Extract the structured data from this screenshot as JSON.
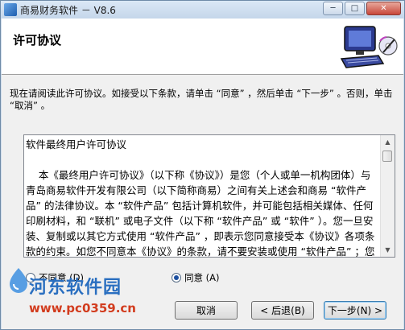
{
  "window": {
    "title": "商易财务软件 － V8.6",
    "minimize_icon": "minimize-icon",
    "maximize_icon": "maximize-icon",
    "close_icon": "close-icon"
  },
  "header": {
    "title": "许可协议",
    "graphic": "computer-disk-icon"
  },
  "intro": "现在请阅读此许可协议。如接受以下条款，请单击 “同意” ，然后单击 “下一步” 。否则，单击 “取消” 。",
  "license": {
    "text": "软件最终用户许可协议\n\n    本《最终用户许可协议》（以下称《协议》）是您（个人或单一机构团体）与青岛商易软件开发有限公司（以下简称商易）之间有关上述会和商易 “软件产品” 的法律协议。本 “软件产品” 包括计算机软件，并可能包括相关媒体、任何印刷材料，和 “联机” 或电子文件（以下称 “软件产品” 或 “软件” ）。您一旦安装、复制或以其它方式使用 “软件产品” ，即表示您同意接受本《协议》各项条款的约束。如您不同意本《协议》的条款，请不要安装或使用 “软件产品” ；您可将其退回原"
  },
  "options": {
    "disagree_label": "不同意 (D)",
    "agree_label": "同意 (A)",
    "selected": "agree"
  },
  "buttons": {
    "cancel": "取消",
    "back": "< 后退(B)",
    "next": "下一步(N) >"
  },
  "watermark": {
    "site_name": "河东软件园",
    "url": "www.pc0359.cn"
  }
}
